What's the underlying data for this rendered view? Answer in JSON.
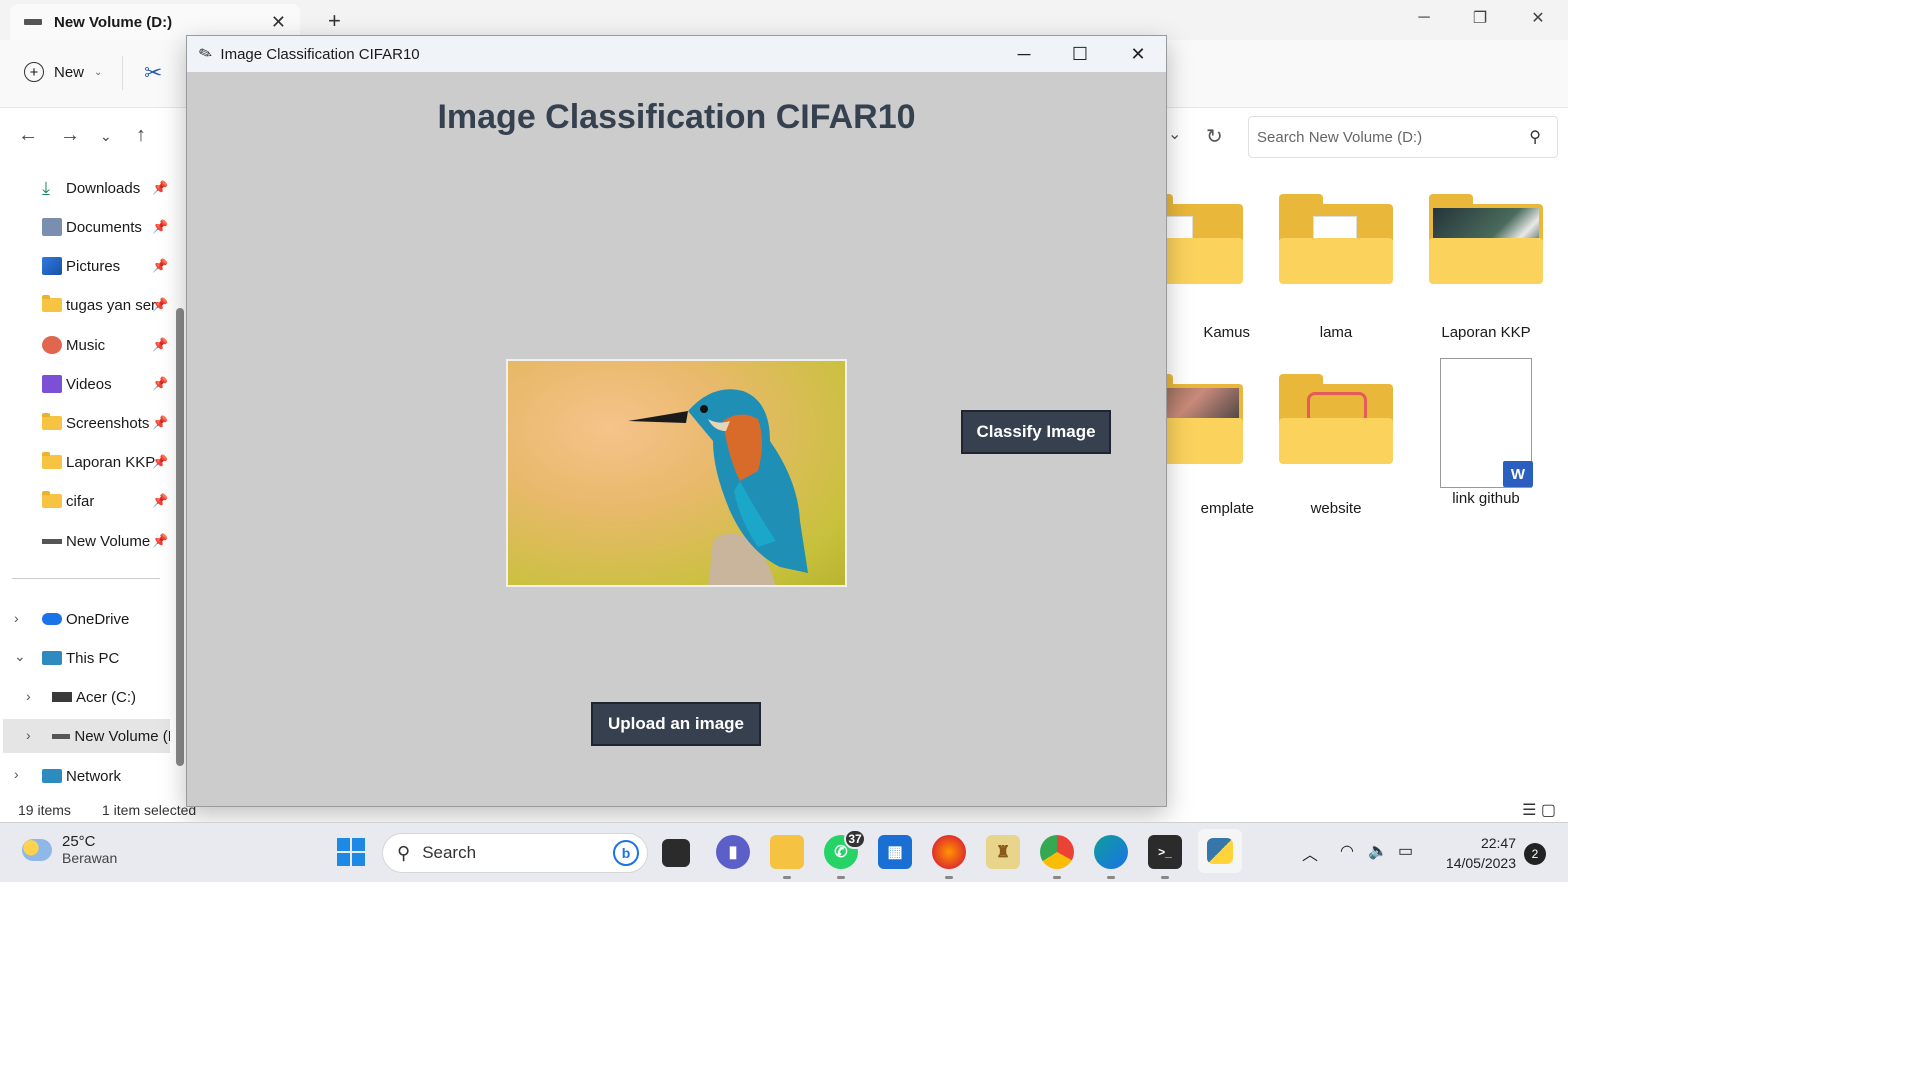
{
  "explorer": {
    "tab_title": "New Volume (D:)",
    "new_label": "New",
    "search_placeholder": "Search New Volume (D:)",
    "sidebar": {
      "quick": [
        {
          "label": "Downloads",
          "icon": "download-icon"
        },
        {
          "label": "Documents",
          "icon": "documents-icon"
        },
        {
          "label": "Pictures",
          "icon": "pictures-icon"
        },
        {
          "label": "tugas yan ser",
          "icon": "folder-icon"
        },
        {
          "label": "Music",
          "icon": "music-icon"
        },
        {
          "label": "Videos",
          "icon": "videos-icon"
        },
        {
          "label": "Screenshots",
          "icon": "folder-icon"
        },
        {
          "label": "Laporan KKP",
          "icon": "folder-icon"
        },
        {
          "label": "cifar",
          "icon": "folder-icon"
        },
        {
          "label": "New Volume",
          "icon": "drive-icon"
        }
      ],
      "onedrive": "OneDrive",
      "this_pc": "This PC",
      "acer": "Acer (C:)",
      "new_volume": "New Volume (D",
      "network": "Network"
    },
    "files": [
      {
        "name": "Kamus"
      },
      {
        "name": "lama"
      },
      {
        "name": "Laporan KKP"
      },
      {
        "name": "emplate"
      },
      {
        "name": "website"
      },
      {
        "name": "link github"
      }
    ],
    "status_items": "19 items",
    "status_selected": "1 item selected",
    "word_badge": "W"
  },
  "dialog": {
    "window_title": "Image Classification CIFAR10",
    "heading": "Image Classification CIFAR10",
    "classify_label": "Classify Image",
    "upload_label": "Upload an image"
  },
  "taskbar": {
    "weather_temp": "25°C",
    "weather_desc": "Berawan",
    "search_label": "Search",
    "whatsapp_badge": "37",
    "time": "22:47",
    "date": "14/05/2023",
    "notifications": "2"
  },
  "colors": {
    "dialog_bg": "#cccccc",
    "button_dark": "#36404e",
    "heading": "#364150",
    "folder": "#fbd25c"
  }
}
